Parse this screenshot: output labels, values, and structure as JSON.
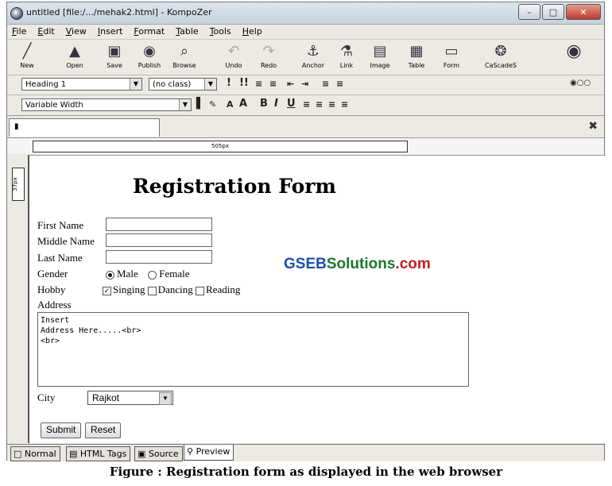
{
  "window": {
    "title": "untitled [file:/.../mehak2.html] - KompoZer"
  },
  "menu": [
    "File",
    "Edit",
    "View",
    "Insert",
    "Format",
    "Table",
    "Tools",
    "Help"
  ],
  "toolbar": [
    {
      "label": "New",
      "icon": "╱",
      "name": "new-button"
    },
    {
      "label": "Open",
      "icon": "▲",
      "name": "open-button"
    },
    {
      "label": "Save",
      "icon": "▣",
      "name": "save-button"
    },
    {
      "label": "Publish",
      "icon": "◉",
      "name": "publish-button"
    },
    {
      "label": "Browse",
      "icon": "⌕",
      "name": "browse-button"
    },
    {
      "label": "Undo",
      "icon": "↶",
      "name": "undo-button"
    },
    {
      "label": "Redo",
      "icon": "↷",
      "name": "redo-button"
    },
    {
      "label": "Anchor",
      "icon": "⚓",
      "name": "anchor-button"
    },
    {
      "label": "Link",
      "icon": "⚗",
      "name": "link-button"
    },
    {
      "label": "Image",
      "icon": "▤",
      "name": "image-button"
    },
    {
      "label": "Table",
      "icon": "▦",
      "name": "table-button"
    },
    {
      "label": "Form",
      "icon": "▭",
      "name": "form-button"
    },
    {
      "label": "CaScadeS",
      "icon": "❂",
      "name": "cascades-button"
    }
  ],
  "format": {
    "paragraph": "Heading 1",
    "class": "(no class)",
    "font": "Variable Width"
  },
  "ruler": {
    "width_label": "505px",
    "height_label": "37px"
  },
  "form": {
    "heading": "Registration Form",
    "first_name": "First Name",
    "middle_name": "Middle Name",
    "last_name": "Last Name",
    "gender": "Gender",
    "male": "Male",
    "female": "Female",
    "hobby": "Hobby",
    "singing": "Singing",
    "dancing": "Dancing",
    "reading": "Reading",
    "address": "Address",
    "address_value": "Insert\nAddress Here.....<br>\n<br>",
    "city": "City",
    "city_value": "Rajkot",
    "submit": "Submit",
    "reset": "Reset"
  },
  "watermark": {
    "gseb": "GSEB",
    "solutions": "Solutions",
    "com": ".com"
  },
  "modes": {
    "normal": "Normal",
    "html_tags": "HTML Tags",
    "source": "Source",
    "preview": "Preview"
  },
  "caption": "Figure : Registration form as displayed in the web browser",
  "colors": {
    "gseb": "#1a4fb0",
    "solutions": "#1a7a2a",
    "com": "#d0192a"
  }
}
